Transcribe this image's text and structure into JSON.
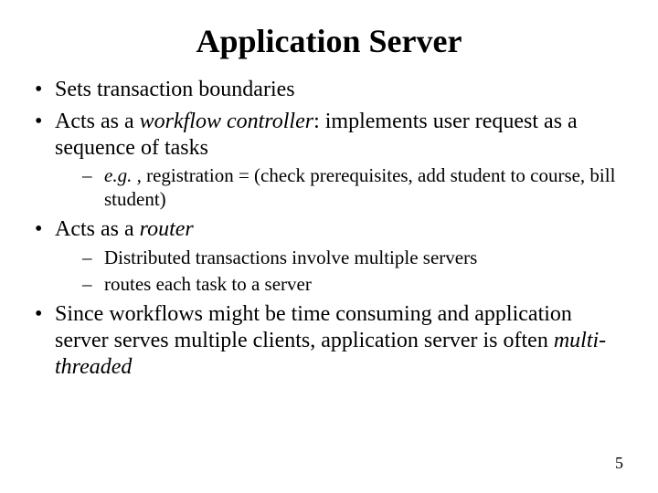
{
  "title": "Application Server",
  "bullets": {
    "b1": "Sets transaction boundaries",
    "b2_pre": "Acts as a ",
    "b2_em": "workflow controller",
    "b2_post": ": implements user request as a sequence of tasks",
    "b2_sub1_em": "e.g. ,",
    "b2_sub1_post": " registration = (check prerequisites, add student to course, bill student)",
    "b3_pre": "Acts as a ",
    "b3_em": "router",
    "b3_sub1": "Distributed transactions involve multiple servers",
    "b3_sub2": "routes each task to a server",
    "b4_pre": "Since workflows might be time consuming and application server serves multiple clients, application server is often ",
    "b4_em": "multi-threaded"
  },
  "page_number": "5"
}
